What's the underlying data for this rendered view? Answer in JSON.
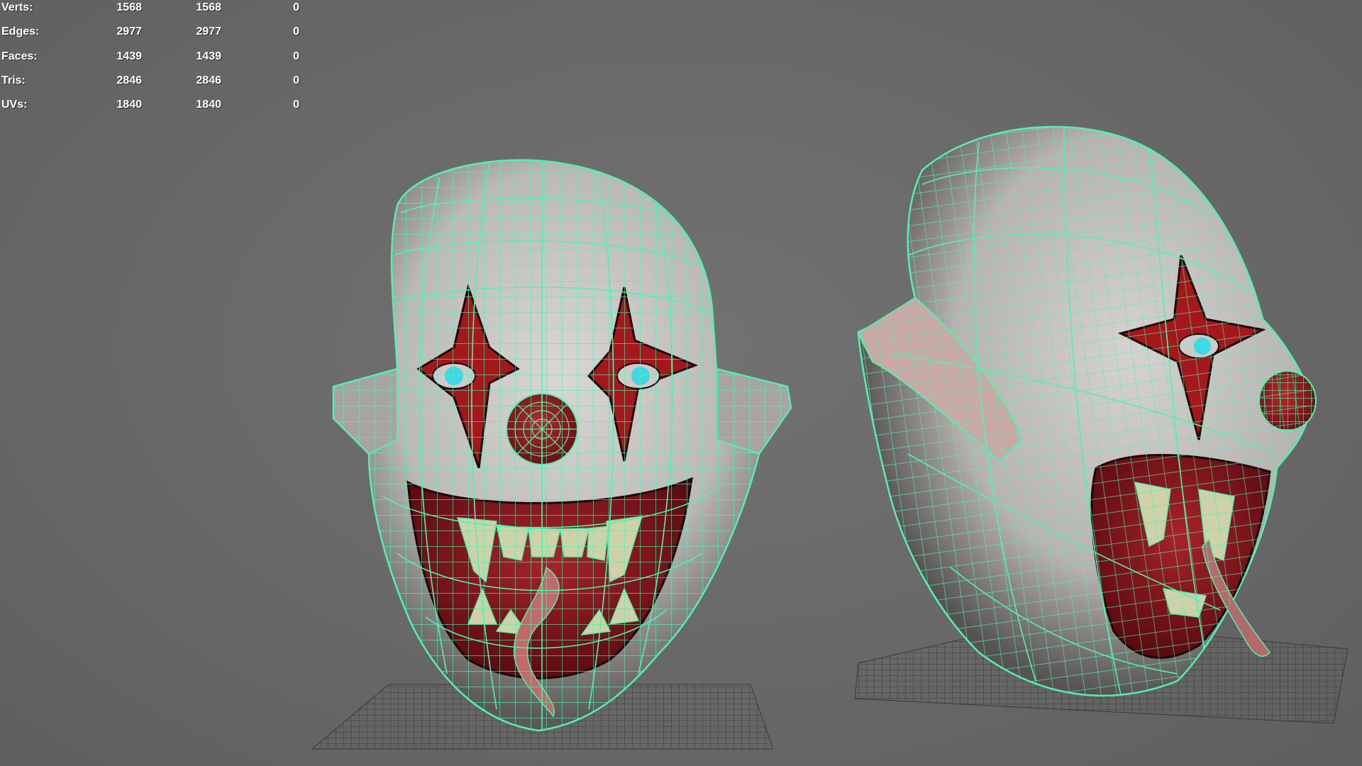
{
  "app": {
    "view": "3D viewport",
    "accent_wire": "#53f0b0",
    "background": "#6b6b6b"
  },
  "hud": {
    "rows": [
      {
        "label": "Verts:",
        "object": "1568",
        "selected": "1568",
        "component": "0"
      },
      {
        "label": "Edges:",
        "object": "2977",
        "selected": "2977",
        "component": "0"
      },
      {
        "label": "Faces:",
        "object": "1439",
        "selected": "1439",
        "component": "0"
      },
      {
        "label": "Tris:",
        "object": "2846",
        "selected": "2846",
        "component": "0"
      },
      {
        "label": "UVs:",
        "object": "1840",
        "selected": "1840",
        "component": "0"
      }
    ]
  },
  "scene": {
    "models": [
      {
        "name": "clown-head",
        "view": "front"
      },
      {
        "name": "clown-head",
        "view": "three-quarter"
      }
    ]
  }
}
